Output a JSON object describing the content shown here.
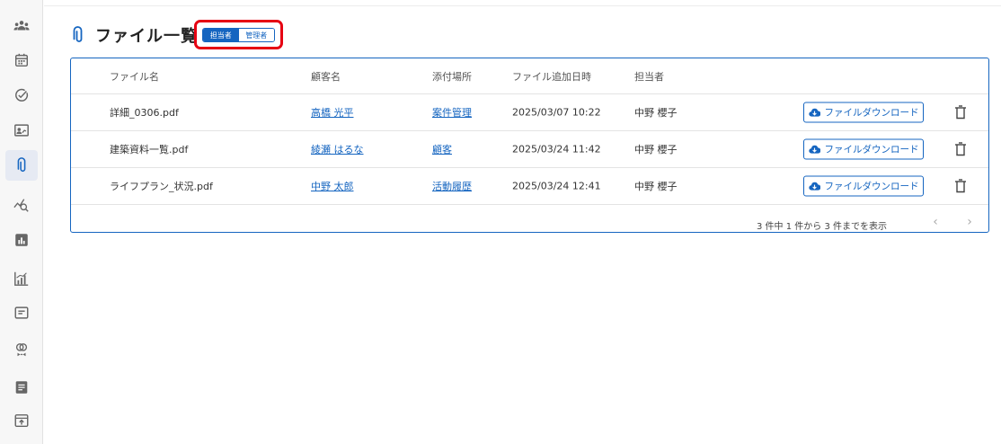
{
  "sidebar": {
    "items": [
      {
        "icon": "people-group-icon",
        "active": false
      },
      {
        "icon": "calendar-icon",
        "active": false
      },
      {
        "icon": "check-circle-icon",
        "active": false
      },
      {
        "icon": "id-card-icon",
        "active": false
      },
      {
        "icon": "paperclip-icon",
        "active": true
      },
      {
        "icon": "chart-search-icon",
        "active": false
      },
      {
        "icon": "bar-chart-box-icon",
        "active": false
      },
      {
        "icon": "analytics-chart-icon",
        "active": false
      },
      {
        "icon": "window-icon",
        "active": false
      },
      {
        "icon": "rings-icon",
        "active": false
      },
      {
        "icon": "document-icon",
        "active": false
      },
      {
        "icon": "upload-box-icon",
        "active": false
      }
    ]
  },
  "header": {
    "title": "ファイル一覧",
    "toggle": {
      "option_1": "担当者",
      "option_2": "管理者",
      "selected": "担当者"
    }
  },
  "table": {
    "columns": {
      "file_name": "ファイル名",
      "customer": "顧客名",
      "attached_to": "添付場所",
      "added_at": "ファイル追加日時",
      "owner": "担当者"
    },
    "rows": [
      {
        "file_name": "詳細_0306.pdf",
        "customer": "高橋 光平",
        "attached_to": "案件管理",
        "added_at": "2025/03/07 10:22",
        "owner": "中野 櫻子",
        "download_label": "ファイルダウンロード"
      },
      {
        "file_name": "建築資料一覧.pdf",
        "customer": "綾瀬 はるな",
        "attached_to": "顧客",
        "added_at": "2025/03/24 11:42",
        "owner": "中野 櫻子",
        "download_label": "ファイルダウンロード"
      },
      {
        "file_name": "ライフプラン_状況.pdf",
        "customer": "中野 太郎",
        "attached_to": "活動履歴",
        "added_at": "2025/03/24 12:41",
        "owner": "中野 櫻子",
        "download_label": "ファイルダウンロード"
      }
    ],
    "pagination": {
      "summary": "3 件中 1 件から 3 件までを表示",
      "prev": "‹",
      "next": "›"
    }
  },
  "colors": {
    "accent": "#1565c0",
    "highlight_border": "#e60012"
  }
}
